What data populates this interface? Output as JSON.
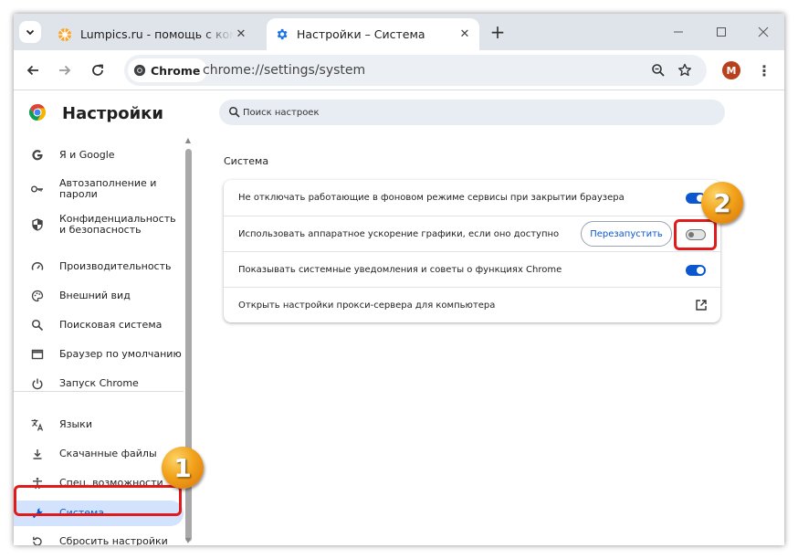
{
  "browser": {
    "tabs": [
      {
        "title": "Lumpics.ru - помощь с компьютером",
        "favicon": "lumpics-favicon",
        "active": false
      },
      {
        "title": "Настройки – Система",
        "favicon": "settings-gear-icon",
        "active": true
      }
    ],
    "new_tab_label": "+",
    "address": {
      "chip_label": "Chrome",
      "url": "chrome://settings/system"
    },
    "profile_initial": "M",
    "profile_color": "#b8401d"
  },
  "settings": {
    "title": "Настройки",
    "search_placeholder": "Поиск настроек",
    "sidebar": {
      "items": [
        {
          "label": "Я и Google",
          "icon": "google-icon"
        },
        {
          "label": "Автозаполнение и пароли",
          "icon": "key-icon"
        },
        {
          "label": "Конфиденциальность и безопасность",
          "icon": "shield-icon"
        },
        {
          "label": "Производительность",
          "icon": "speedometer-icon"
        },
        {
          "label": "Внешний вид",
          "icon": "palette-icon"
        },
        {
          "label": "Поисковая система",
          "icon": "search-icon"
        },
        {
          "label": "Браузер по умолчанию",
          "icon": "browser-window-icon"
        },
        {
          "label": "Запуск Chrome",
          "icon": "power-icon"
        },
        {
          "label": "Языки",
          "icon": "translate-icon"
        },
        {
          "label": "Скачанные файлы",
          "icon": "download-icon"
        },
        {
          "label": "Спец. возможности",
          "icon": "accessibility-icon"
        },
        {
          "label": "Система",
          "icon": "wrench-icon",
          "active": true
        },
        {
          "label": "Сбросить настройки",
          "icon": "reset-icon"
        }
      ]
    },
    "section": {
      "title": "Система",
      "rows": [
        {
          "label": "Не отключать работающие в фоновом режиме сервисы при закрытии браузера",
          "control": "toggle",
          "on": true
        },
        {
          "label": "Использовать аппаратное ускорение графики, если оно доступно",
          "control": "toggle",
          "on": false,
          "button": "Перезапустить"
        },
        {
          "label": "Показывать системные уведомления и советы о функциях Chrome",
          "control": "toggle",
          "on": true
        },
        {
          "label": "Открыть настройки прокси-сервера для компьютера",
          "control": "external-link"
        }
      ]
    }
  },
  "annotations": {
    "step1": "1",
    "step2": "2",
    "highlight_color": "#e01b1b"
  }
}
